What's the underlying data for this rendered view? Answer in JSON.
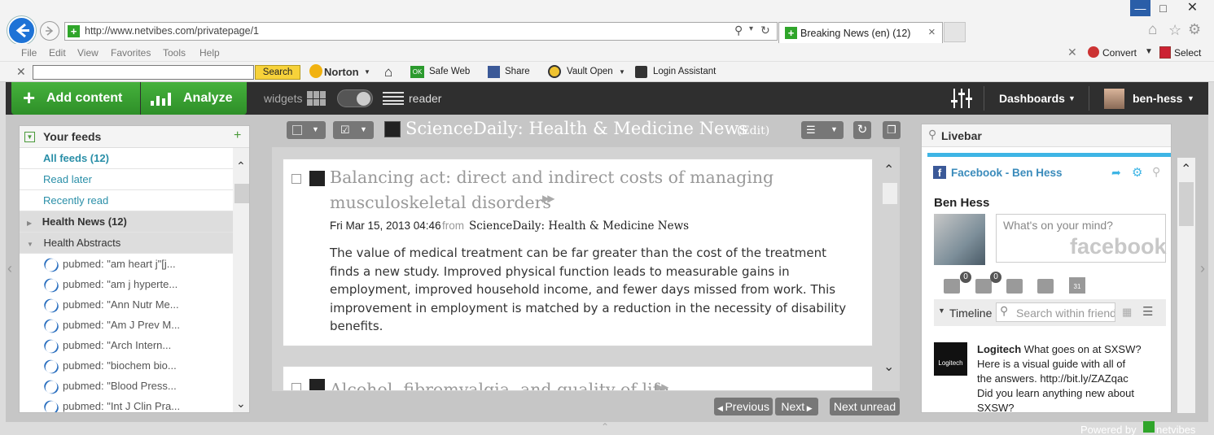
{
  "browser": {
    "url": "http://www.netvibes.com/privatepage/1",
    "tab_title": "Breaking News (en) (12)",
    "menu": [
      "File",
      "Edit",
      "View",
      "Favorites",
      "Tools",
      "Help"
    ],
    "convert_label": "Convert",
    "select_label": "Select",
    "toolbar": {
      "search_button": "Search",
      "norton": "Norton",
      "safe_web": "Safe Web",
      "share": "Share",
      "vault": "Vault Open",
      "login_assistant": "Login Assistant",
      "ok_badge": "OK"
    }
  },
  "header": {
    "add_content": "Add content",
    "analyze": "Analyze",
    "widgets": "widgets",
    "reader": "reader",
    "dashboards": "Dashboards",
    "user": "ben-hess"
  },
  "feeds": {
    "title": "Your feeds",
    "items": [
      {
        "label": "All feeds  (12)"
      },
      {
        "label": "Read later"
      },
      {
        "label": "Recently read"
      }
    ],
    "groups": [
      {
        "label": "Health News  (12)"
      },
      {
        "label": "Health Abstracts"
      }
    ],
    "pubmed": [
      "pubmed: \"am heart j\"[j...",
      "pubmed: \"am j hyperte...",
      "pubmed: \"Ann Nutr Me...",
      "pubmed: \"Am J Prev M...",
      "pubmed: \"Arch Intern...",
      "pubmed: \"biochem bio...",
      "pubmed: \"Blood Press...",
      "pubmed: \"Int J Clin Pra..."
    ]
  },
  "feed_title": "ScienceDaily: Health & Medicine News",
  "feed_edit": "(Edit)",
  "articles": [
    {
      "title_line1": "Balancing act: direct and indirect costs of managing",
      "title_line2": "musculoskeletal disorders",
      "date": "Fri Mar 15, 2013 04:46",
      "from": "from",
      "source": "ScienceDaily: Health & Medicine News",
      "body_lines": [
        "The value of medical treatment can be far greater than the cost of the treatment",
        "finds a new study. Improved physical function leads to measurable gains in",
        "employment, improved household income, and fewer days missed from work. This",
        "improvement in employment is matched by a reduction in the necessity of disability",
        "benefits."
      ]
    },
    {
      "title_line1": "Alcohol, fibromyalgia, and quality of life"
    }
  ],
  "nav": {
    "previous": "Previous",
    "next": "Next",
    "next_unread": "Next unread"
  },
  "livebar": {
    "title": "Livebar",
    "fb_title": "Facebook - Ben Hess",
    "name": "Ben Hess",
    "status_placeholder": "What's on your mind?",
    "fb_logo": "facebook",
    "badge1": "0",
    "badge2": "0",
    "calendar_day": "31",
    "timeline": "Timeline",
    "search_placeholder": "Search within friends",
    "post_author": "Logitech",
    "post_text_lines": [
      "What goes on at SXSW?",
      "Here is a visual guide with all of",
      "the answers. http://bit.ly/ZAZqac",
      "Did you learn anything new about",
      "SXSW?"
    ],
    "logo_text": "Logitech"
  },
  "footer": {
    "powered_by": "Powered by",
    "brand": "netvibes"
  }
}
